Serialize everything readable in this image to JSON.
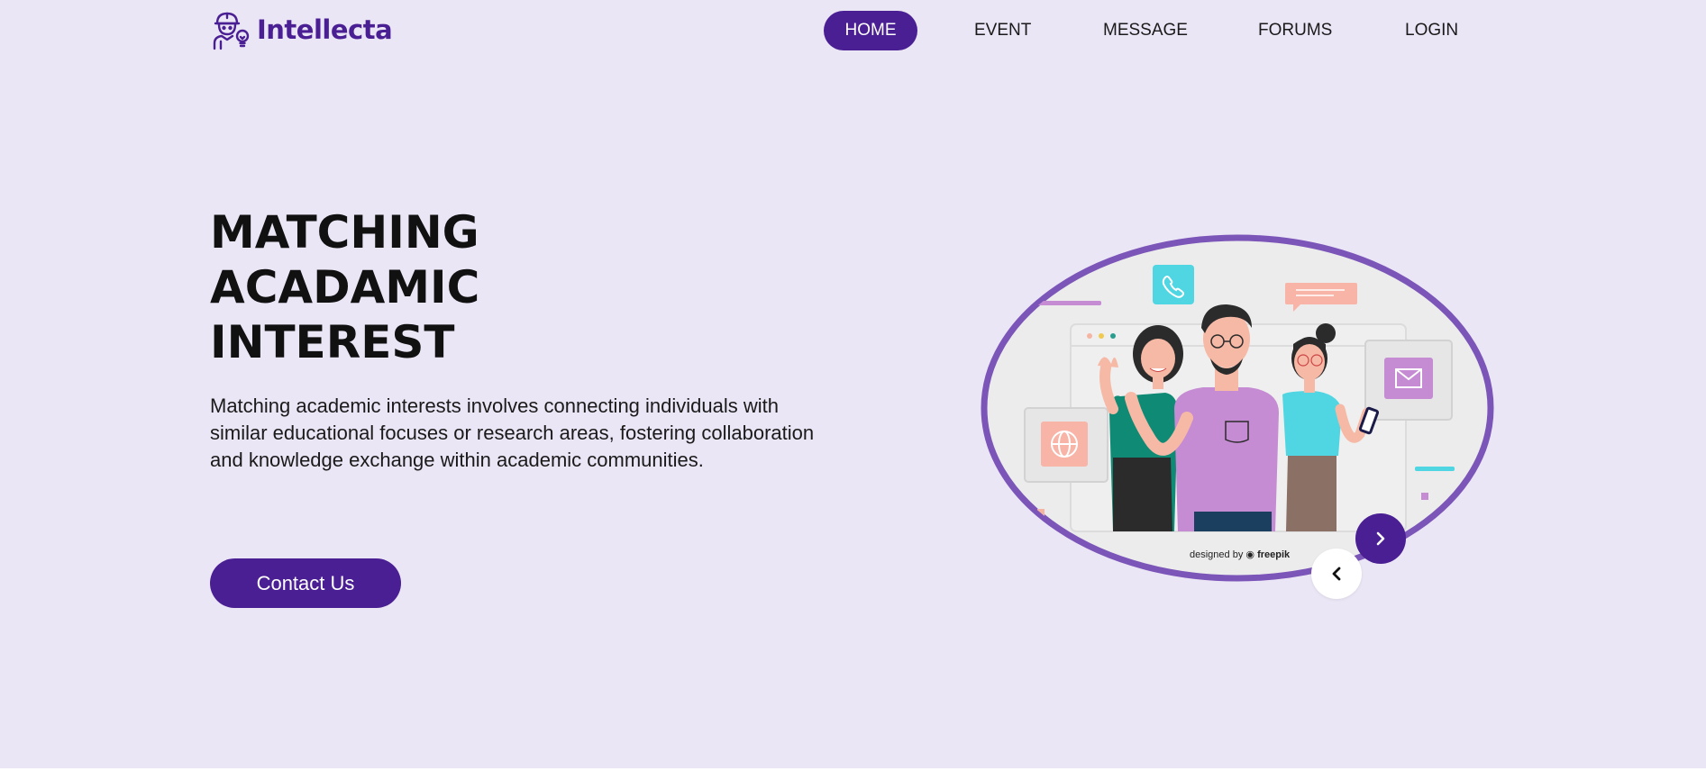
{
  "brand": {
    "name": "Intellecta",
    "logo_icon": "worker-lightbulb-icon",
    "color": "#4a1f93"
  },
  "nav": {
    "items": [
      {
        "label": "HOME",
        "active": true
      },
      {
        "label": "EVENT",
        "active": false
      },
      {
        "label": "MESSAGE",
        "active": false
      },
      {
        "label": "FORUMS",
        "active": false
      },
      {
        "label": "LOGIN",
        "active": false
      }
    ]
  },
  "hero": {
    "title_lines": [
      "MATCHING",
      "ACADAMIC",
      "INTEREST"
    ],
    "description": "Matching academic interests involves connecting individuals with similar educational focuses or research areas, fostering collaboration and knowledge exchange within academic communities.",
    "cta_label": "Contact Us"
  },
  "illustration": {
    "credit_prefix": "designed by",
    "credit_brand": "freepik",
    "ring_color": "#7b55b8"
  },
  "slider": {
    "next_icon": "chevron-right-icon",
    "prev_icon": "chevron-left-icon"
  },
  "colors": {
    "background": "#ebe6f5",
    "accent": "#4a1f93"
  }
}
